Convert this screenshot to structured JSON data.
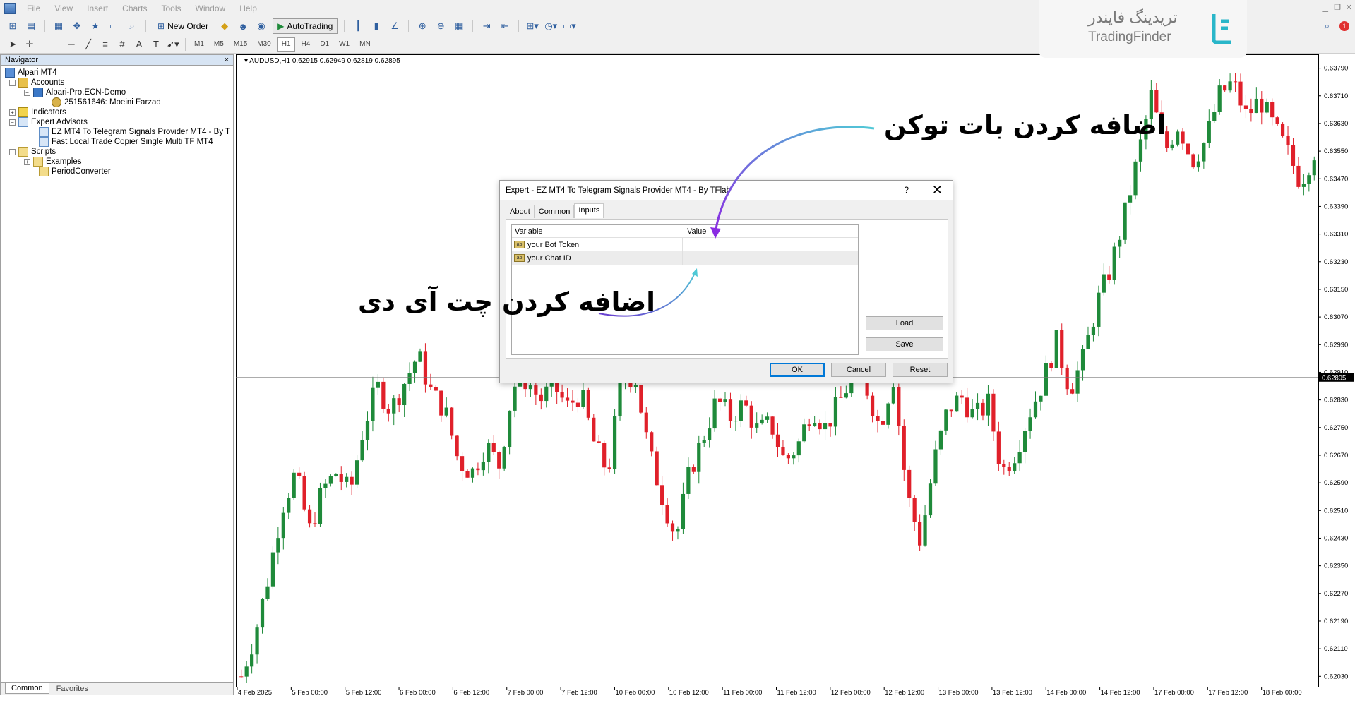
{
  "menu": [
    "File",
    "View",
    "Insert",
    "Charts",
    "Tools",
    "Window",
    "Help"
  ],
  "toolbar": {
    "new_order_label": "New Order",
    "autotrading_label": "AutoTrading",
    "timeframes": [
      "M1",
      "M5",
      "M15",
      "M30",
      "H1",
      "H4",
      "D1",
      "W1",
      "MN"
    ],
    "active_timeframe": "H1"
  },
  "navigator": {
    "title": "Navigator",
    "close": "×",
    "root": "Alpari MT4",
    "accounts": "Accounts",
    "server": "Alpari-Pro.ECN-Demo",
    "account": "251561646: Moeini Farzad",
    "indicators": "Indicators",
    "expert_advisors": "Expert Advisors",
    "ea_items": [
      "EZ MT4 To Telegram Signals Provider MT4 - By T",
      "Fast Local Trade Copier Single Multi TF MT4"
    ],
    "scripts": "Scripts",
    "script_items": [
      "Examples",
      "PeriodConverter"
    ],
    "tabs": [
      "Common",
      "Favorites"
    ]
  },
  "chart": {
    "header": "AUDUSD,H1  0.62915 0.62949 0.62819 0.62895",
    "current_price": "0.62895",
    "x_labels": [
      "4 Feb 2025",
      "5 Feb 00:00",
      "5 Feb 12:00",
      "6 Feb 00:00",
      "6 Feb 12:00",
      "7 Feb 00:00",
      "7 Feb 12:00",
      "10 Feb 00:00",
      "10 Feb 12:00",
      "11 Feb 00:00",
      "11 Feb 12:00",
      "12 Feb 00:00",
      "12 Feb 12:00",
      "13 Feb 00:00",
      "13 Feb 12:00",
      "14 Feb 00:00",
      "14 Feb 12:00",
      "17 Feb 00:00",
      "17 Feb 12:00",
      "18 Feb 00:00"
    ],
    "y_labels": [
      "0.63790",
      "0.63710",
      "0.63630",
      "0.63550",
      "0.63470",
      "0.63390",
      "0.63310",
      "0.63230",
      "0.63150",
      "0.63070",
      "0.62990",
      "0.62910",
      "0.62830",
      "0.62750",
      "0.62670",
      "0.62590",
      "0.62510",
      "0.62430",
      "0.62350",
      "0.62270",
      "0.62190",
      "0.62110",
      "0.62030"
    ],
    "bull_color": "#1f8a3a",
    "bear_color": "#e0202a"
  },
  "chart_data": {
    "type": "candlestick",
    "symbol": "AUDUSD",
    "timeframe": "H1",
    "last": {
      "open": 0.62915,
      "high": 0.62949,
      "low": 0.62819,
      "close": 0.62895
    },
    "ylim": [
      0.62,
      0.6383
    ],
    "x_ticks": [
      "4 Feb 2025",
      "5 Feb 00:00",
      "5 Feb 12:00",
      "6 Feb 00:00",
      "6 Feb 12:00",
      "7 Feb 00:00",
      "7 Feb 12:00",
      "10 Feb 00:00",
      "10 Feb 12:00",
      "11 Feb 00:00",
      "11 Feb 12:00",
      "12 Feb 00:00",
      "12 Feb 12:00",
      "13 Feb 00:00",
      "13 Feb 12:00",
      "14 Feb 00:00",
      "14 Feb 12:00",
      "17 Feb 00:00",
      "17 Feb 12:00",
      "18 Feb 00:00"
    ],
    "close_path": [
      0.6203,
      0.6215,
      0.6232,
      0.6252,
      0.6262,
      0.6245,
      0.6257,
      0.6262,
      0.6256,
      0.6275,
      0.6287,
      0.628,
      0.6288,
      0.6296,
      0.6285,
      0.628,
      0.6265,
      0.6262,
      0.627,
      0.6264,
      0.6287,
      0.6289,
      0.6283,
      0.6287,
      0.6281,
      0.6285,
      0.627,
      0.6262,
      0.6289,
      0.629,
      0.6268,
      0.6255,
      0.6243,
      0.6262,
      0.6272,
      0.6283,
      0.6278,
      0.6282,
      0.6274,
      0.6276,
      0.6265,
      0.627,
      0.6281,
      0.6275,
      0.6282,
      0.629,
      0.6287,
      0.6275,
      0.629,
      0.6256,
      0.6242,
      0.6265,
      0.628,
      0.6284,
      0.6278,
      0.6282,
      0.6262,
      0.6268,
      0.6279,
      0.6288,
      0.63,
      0.6286,
      0.6295,
      0.6311,
      0.6321,
      0.6336,
      0.6353,
      0.6371,
      0.6355,
      0.6363,
      0.6352,
      0.6358,
      0.6371,
      0.6375,
      0.6365,
      0.637,
      0.6362,
      0.6355,
      0.6346,
      0.6355
    ],
    "bull_color": "#1f8a3a",
    "bear_color": "#e0202a"
  },
  "dialog": {
    "title": "Expert - EZ MT4 To Telegram Signals Provider MT4 - By TFlab",
    "help": "?",
    "close": "✕",
    "tabs": [
      "About",
      "Common",
      "Inputs"
    ],
    "active_tab": "Inputs",
    "columns": [
      "Variable",
      "Value"
    ],
    "rows": [
      {
        "variable": "your Bot Token",
        "value": ""
      },
      {
        "variable": "your Chat ID",
        "value": ""
      }
    ],
    "type_badge": "ab",
    "load": "Load",
    "save": "Save",
    "ok": "OK",
    "cancel": "Cancel",
    "reset": "Reset"
  },
  "annotations": {
    "bot_token": "اضافه کردن بات توکن",
    "chat_id": "اضافه کردن چت آی دی"
  },
  "watermark": {
    "persian": "تریدینگ فایندر",
    "english": "TradingFinder",
    "accent": "#29b6c9"
  },
  "notifications": "1"
}
